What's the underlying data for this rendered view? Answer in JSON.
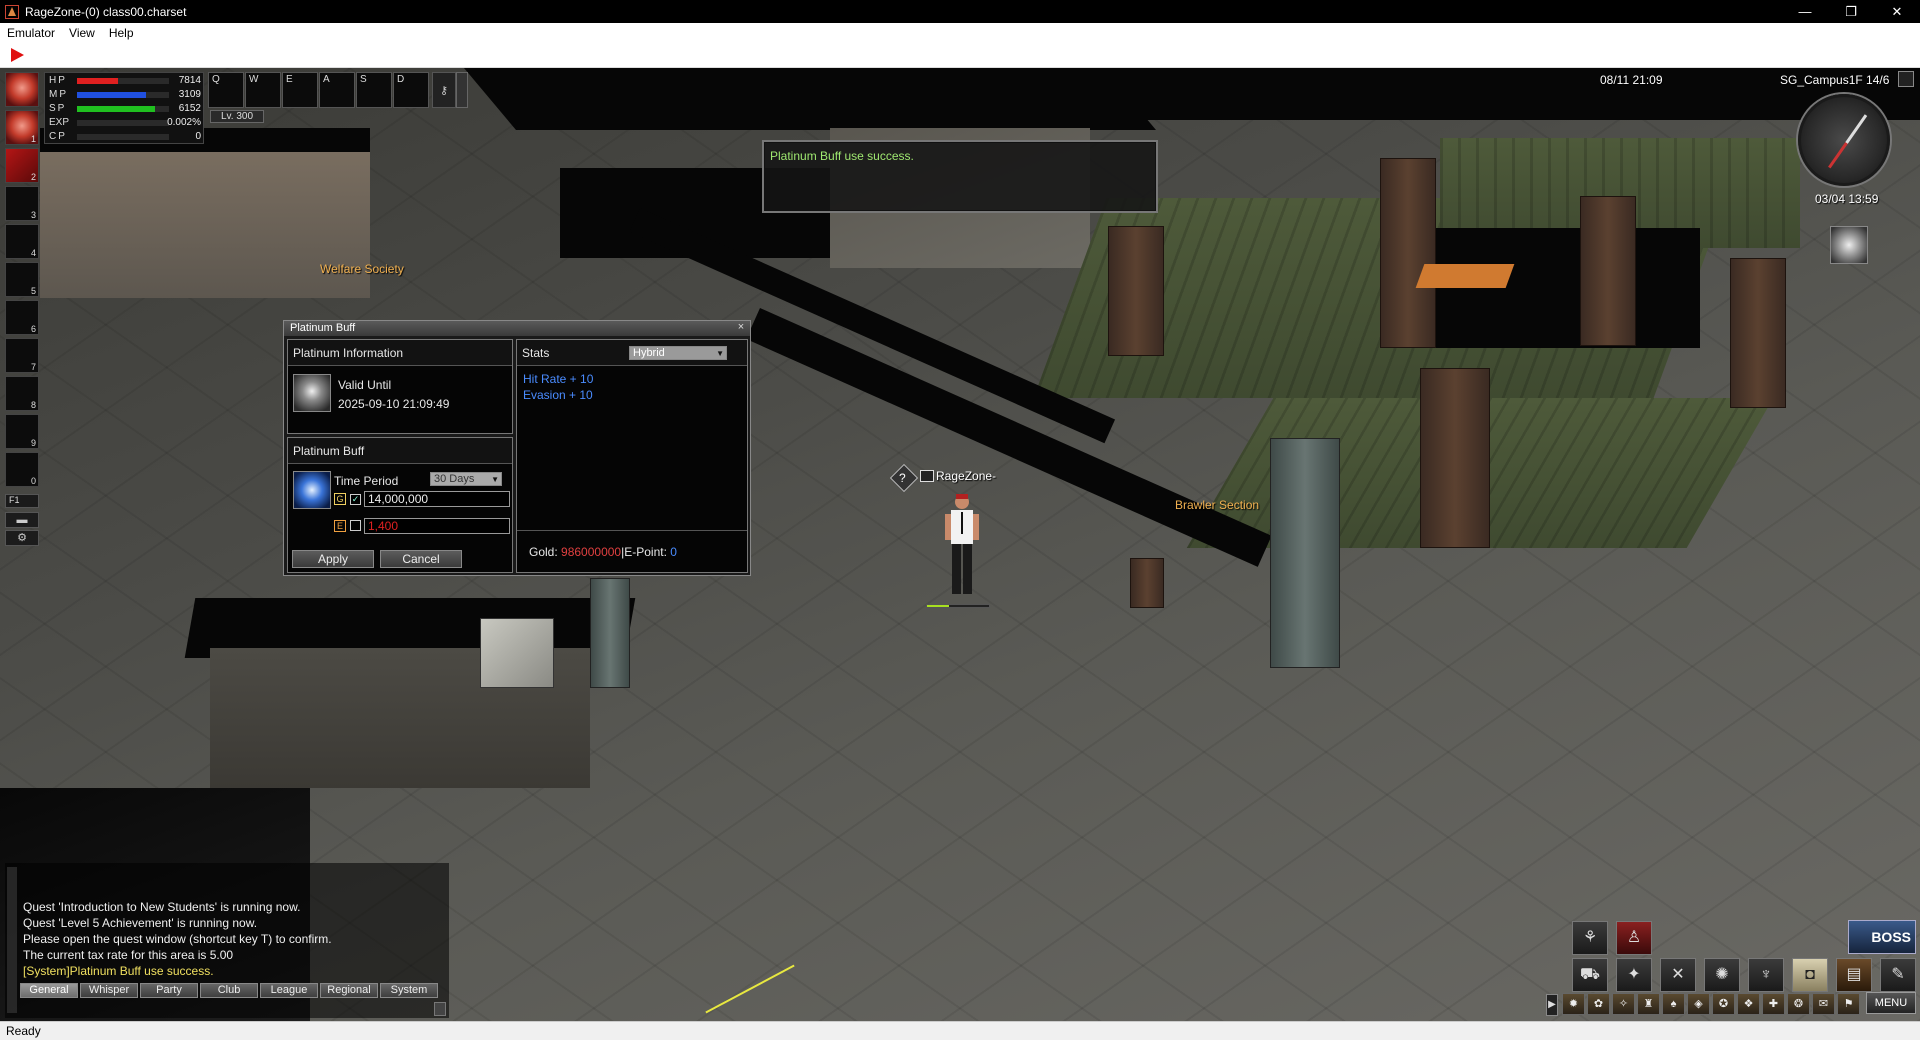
{
  "window": {
    "title": "RageZone-(0) class00.charset",
    "minimize": "—",
    "restore": "❐",
    "close": "✕"
  },
  "menu": {
    "emulator": "Emulator",
    "view": "View",
    "help": "Help"
  },
  "status": {
    "text": "Ready"
  },
  "hud": {
    "bars": [
      {
        "label": "HP",
        "value": "7814",
        "fill": 0.45,
        "color": "#e02020"
      },
      {
        "label": "MP",
        "value": "3109",
        "fill": 0.75,
        "color": "#2050e0"
      },
      {
        "label": "SP",
        "value": "6152",
        "fill": 0.85,
        "color": "#20c020"
      },
      {
        "label": "EXP",
        "value": "0.002%",
        "fill": 0.0,
        "color": "#d0d020"
      },
      {
        "label": "CP",
        "value": "0",
        "fill": 0.0,
        "color": "#d08020"
      }
    ],
    "hotkeys": [
      "Q",
      "W",
      "E",
      "A",
      "S",
      "D"
    ],
    "level": "Lv. 300",
    "quickslots": [
      "1",
      "2",
      "3",
      "4",
      "5",
      "6",
      "7",
      "8",
      "9",
      "0"
    ],
    "f1": "F1",
    "settings_icon": "⚙"
  },
  "top_right": {
    "clock": "08/11 21:09",
    "map_name": "SG_Campus1F 14/6",
    "server_time": "03/04 13:59"
  },
  "zones": {
    "welfare": "Welfare Society",
    "brawler": "Brawler Section"
  },
  "notification": {
    "message": "Platinum Buff use success."
  },
  "platinum": {
    "title": "Platinum Buff",
    "close": "×",
    "info_header": "Platinum Information",
    "valid_until_label": "Valid Until",
    "valid_until_value": "2025-09-10 21:09:49",
    "buff_header": "Platinum Buff",
    "time_period_label": "Time Period",
    "time_period_value": "30 Days",
    "gold_cost": "14,000,000",
    "epoint_cost": "1,400",
    "gold_check": "✓",
    "epoint_check": "",
    "gold_icon": "G",
    "epoint_icon": "E",
    "apply": "Apply",
    "cancel": "Cancel",
    "stats_label": "Stats",
    "stats_value": "Hybrid",
    "stat_lines": [
      "Hit Rate + 10",
      "Evasion + 10"
    ],
    "gold_label": "Gold:",
    "gold_value": "986000000",
    "epoint_label": "|E-Point:",
    "epoint_value": "0"
  },
  "character": {
    "name": "RageZone-",
    "quest_mark": "?",
    "hp_fill": 0.35
  },
  "chat": {
    "lines": [
      {
        "text": "Quest 'Introduction to New Students' is running now.",
        "type": "normal"
      },
      {
        "text": "Quest 'Level 5 Achievement' is running now.",
        "type": "normal"
      },
      {
        "text": "Please open the quest window (shortcut key T) to confirm.",
        "type": "normal"
      },
      {
        "text": "The current tax rate for this area is 5.00",
        "type": "normal"
      },
      {
        "text": "[System]Platinum Buff use success.",
        "type": "sys"
      }
    ],
    "tabs": [
      "General",
      "Whisper",
      "Party",
      "Club",
      "League",
      "Regional",
      "System"
    ]
  },
  "bottom_right": {
    "boss": "BOSS",
    "menu": "MENU",
    "arrow": "▶"
  },
  "colors": {
    "accent_green": "#9fe870",
    "stat_blue": "#4a8cff",
    "cost_red": "#e02020",
    "zone_orange": "#f0b050"
  }
}
